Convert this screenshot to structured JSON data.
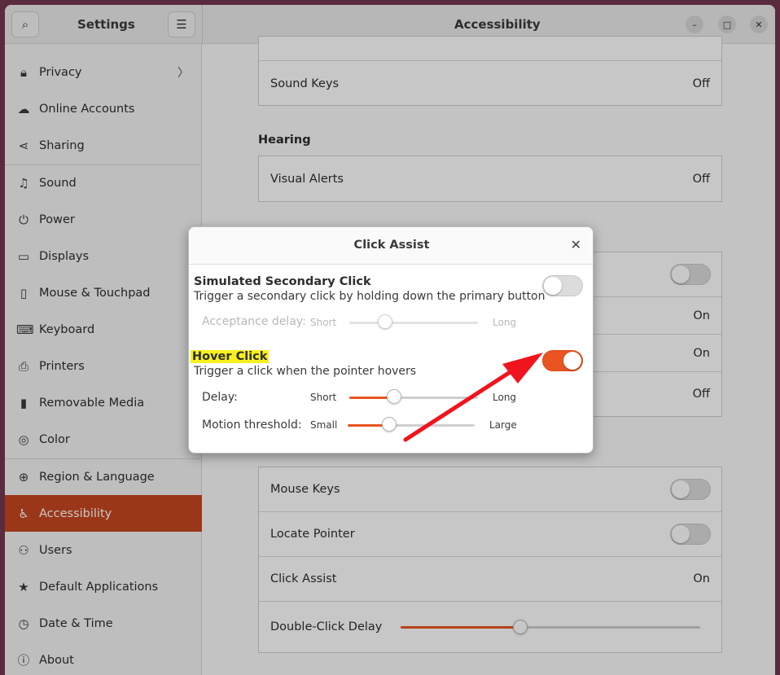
{
  "sidebar": {
    "title": "Settings",
    "items": [
      {
        "label": "Privacy",
        "icon": "lock-icon",
        "glyph": "🔒︎",
        "chevron": "〉"
      },
      {
        "label": "Online Accounts",
        "icon": "cloud-icon",
        "glyph": "☁"
      },
      {
        "label": "Sharing",
        "icon": "share-icon",
        "glyph": "⋖"
      },
      {
        "label": "Sound",
        "icon": "music-note-icon",
        "glyph": "♫"
      },
      {
        "label": "Power",
        "icon": "power-icon",
        "glyph": "⏻"
      },
      {
        "label": "Displays",
        "icon": "display-icon",
        "glyph": "▭"
      },
      {
        "label": "Mouse & Touchpad",
        "icon": "mouse-icon",
        "glyph": "▯"
      },
      {
        "label": "Keyboard",
        "icon": "keyboard-icon",
        "glyph": "⌨"
      },
      {
        "label": "Printers",
        "icon": "printer-icon",
        "glyph": "⎙"
      },
      {
        "label": "Removable Media",
        "icon": "usb-icon",
        "glyph": "▮"
      },
      {
        "label": "Color",
        "icon": "color-icon",
        "glyph": "◎"
      },
      {
        "label": "Region & Language",
        "icon": "globe-icon",
        "glyph": "⊕"
      },
      {
        "label": "Accessibility",
        "icon": "accessibility-icon",
        "glyph": "♿︎"
      },
      {
        "label": "Users",
        "icon": "users-icon",
        "glyph": "⚇"
      },
      {
        "label": "Default Applications",
        "icon": "star-icon",
        "glyph": "★"
      },
      {
        "label": "Date & Time",
        "icon": "clock-icon",
        "glyph": "◷"
      },
      {
        "label": "About",
        "icon": "info-icon",
        "glyph": "ⓘ"
      }
    ]
  },
  "header": {
    "title": "Accessibility",
    "search_glyph": "⌕",
    "menu_glyph": "☰",
    "minimize_glyph": "–",
    "maximize_glyph": "□",
    "close_glyph": "✕"
  },
  "main": {
    "sound_keys": {
      "label": "Sound Keys",
      "value": "Off"
    },
    "hearing_title": "Hearing",
    "visual_alerts": {
      "label": "Visual Alerts",
      "value": "Off"
    },
    "hidden_rows": {
      "row2_value": "On",
      "row3_value": "On",
      "row4_value": "Off"
    },
    "mouse_keys": {
      "label": "Mouse Keys",
      "state": "off"
    },
    "locate_pointer": {
      "label": "Locate Pointer",
      "state": "off"
    },
    "click_assist": {
      "label": "Click Assist",
      "value": "On"
    },
    "double_click_delay": {
      "label": "Double-Click Delay",
      "level": 0.4
    }
  },
  "dialog": {
    "title": "Click Assist",
    "close_glyph": "✕",
    "secondary": {
      "title": "Simulated Secondary Click",
      "subtitle": "Trigger a secondary click by holding down the primary button",
      "state": "off",
      "delay_label": "Acceptance delay:",
      "min_label": "Short",
      "max_label": "Long",
      "level": 0.28
    },
    "hover": {
      "title": "Hover Click",
      "subtitle": "Trigger a click when the pointer hovers",
      "state": "on",
      "delay_label": "Delay:",
      "delay_min": "Short",
      "delay_max": "Long",
      "delay_level": 0.35,
      "motion_label": "Motion threshold:",
      "motion_min": "Small",
      "motion_max": "Large",
      "motion_level": 0.33
    }
  },
  "colors": {
    "accent": "#e95420",
    "active_sidebar": "#c6471f",
    "arrow": "#f0141e",
    "highlight": "#f7f01f"
  }
}
